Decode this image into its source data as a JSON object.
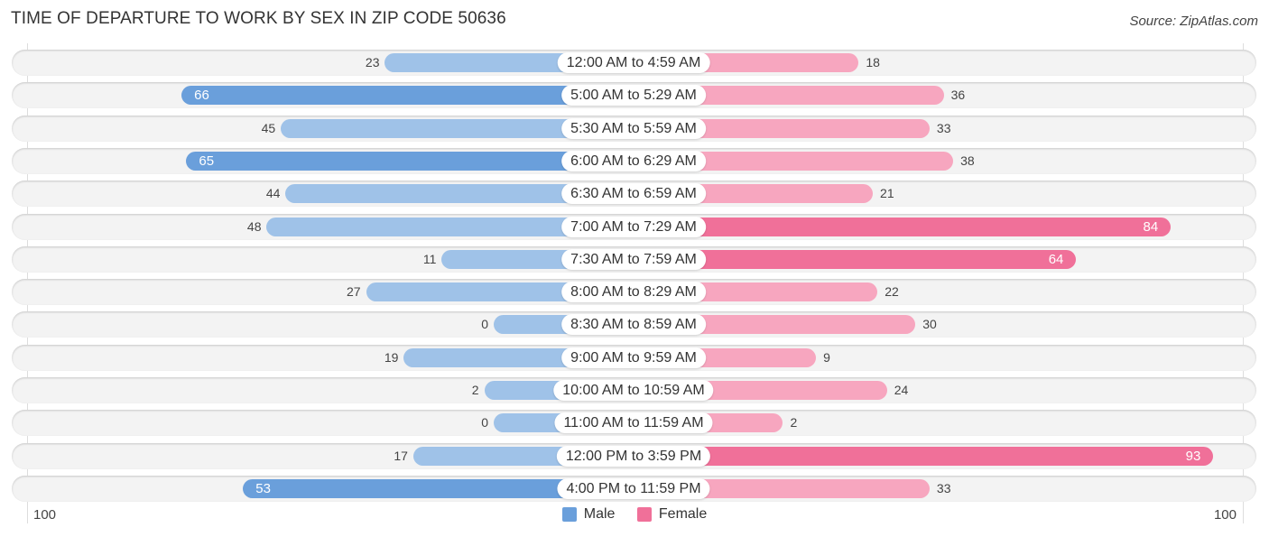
{
  "title": "TIME OF DEPARTURE TO WORK BY SEX IN ZIP CODE 50636",
  "source": "Source: ZipAtlas.com",
  "colors": {
    "male_strong": "#6a9fdb",
    "male_light": "#9fc2e8",
    "female_strong": "#f07099",
    "female_light": "#f7a6bf"
  },
  "chart_data": {
    "type": "bar",
    "orientation": "horizontal-diverging",
    "title": "TIME OF DEPARTURE TO WORK BY SEX IN ZIP CODE 50636",
    "categories": [
      "12:00 AM to 4:59 AM",
      "5:00 AM to 5:29 AM",
      "5:30 AM to 5:59 AM",
      "6:00 AM to 6:29 AM",
      "6:30 AM to 6:59 AM",
      "7:00 AM to 7:29 AM",
      "7:30 AM to 7:59 AM",
      "8:00 AM to 8:29 AM",
      "8:30 AM to 8:59 AM",
      "9:00 AM to 9:59 AM",
      "10:00 AM to 10:59 AM",
      "11:00 AM to 11:59 AM",
      "12:00 PM to 3:59 PM",
      "4:00 PM to 11:59 PM"
    ],
    "series": [
      {
        "name": "Male",
        "values": [
          23,
          66,
          45,
          65,
          44,
          48,
          11,
          27,
          0,
          19,
          2,
          0,
          17,
          53
        ]
      },
      {
        "name": "Female",
        "values": [
          18,
          36,
          33,
          38,
          21,
          84,
          64,
          22,
          30,
          9,
          24,
          2,
          93,
          33
        ]
      }
    ],
    "axis": {
      "left_label": "100",
      "right_label": "100",
      "range": [
        0,
        100
      ]
    },
    "legend": {
      "position": "bottom-center",
      "items": [
        "Male",
        "Female"
      ]
    },
    "grid": false
  }
}
